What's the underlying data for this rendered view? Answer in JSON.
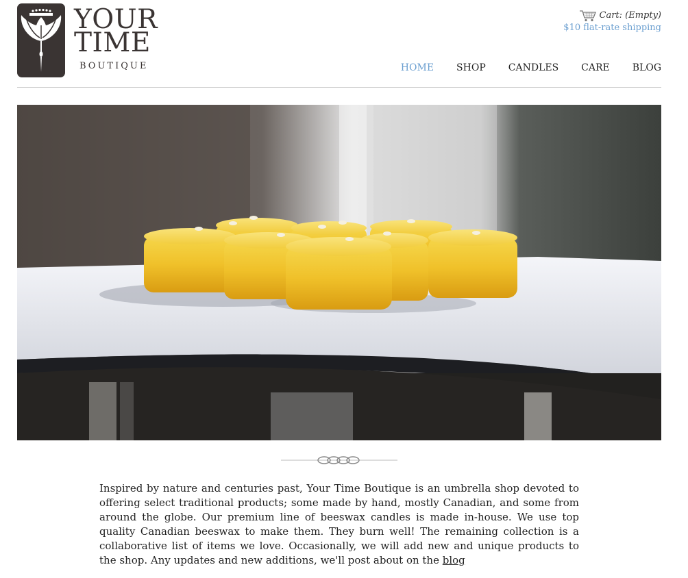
{
  "brand": {
    "name_line1": "YOUR",
    "name_line2": "TIME",
    "name_line3": "BOUTIQUE"
  },
  "cart": {
    "label": "Cart: (Empty)",
    "shipping": "$10 flat-rate shipping"
  },
  "nav": [
    {
      "label": "HOME",
      "active": true
    },
    {
      "label": "SHOP",
      "active": false
    },
    {
      "label": "CANDLES",
      "active": false
    },
    {
      "label": "CARE",
      "active": false
    },
    {
      "label": "BLOG",
      "active": false
    }
  ],
  "intro": {
    "text": "Inspired by nature and centuries past, Your Time Boutique is an umbrella shop devoted to offering select traditional products; some made by hand, mostly Canadian, and some from around the globe. Our premium line of beeswax candles is made in-house. We use top quality Canadian beeswax to make them. They burn well! The remaining collection is a collaborative list of items we love. Occasionally, we will add new and unique products to the shop. Any updates and new additions, we'll post about on the ",
    "link": "blog"
  },
  "colors": {
    "accent": "#6b9fd0",
    "logo": "#3a3433"
  }
}
